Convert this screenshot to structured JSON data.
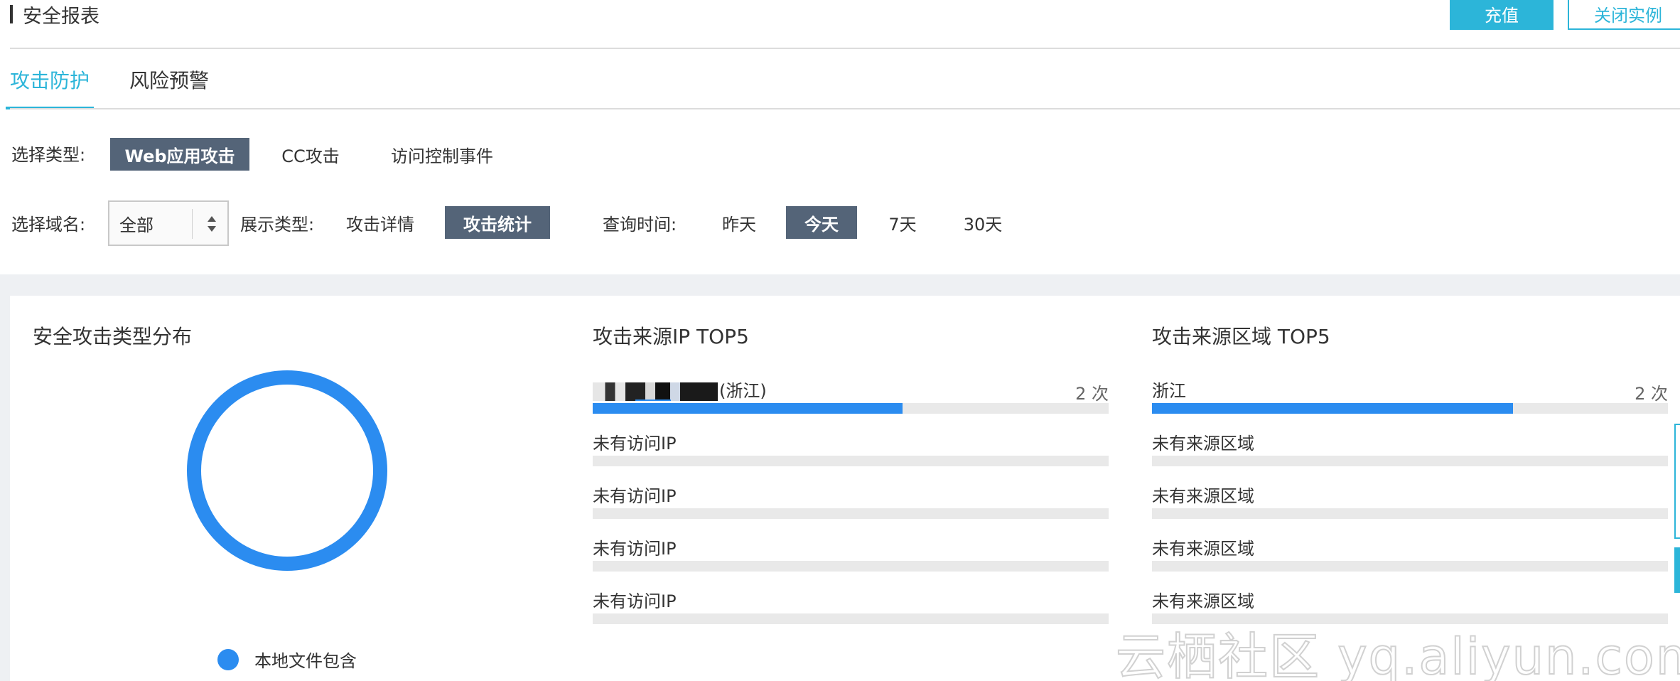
{
  "header": {
    "title": "安全报表",
    "recharge_label": "充值",
    "close_instance_label": "关闭实例"
  },
  "tabs": [
    {
      "label": "攻击防护",
      "active": true
    },
    {
      "label": "风险预警",
      "active": false
    }
  ],
  "filters": {
    "type_label": "选择类型:",
    "type_options": [
      {
        "label": "Web应用攻击",
        "active": true
      },
      {
        "label": "CC攻击",
        "active": false
      },
      {
        "label": "访问控制事件",
        "active": false
      }
    ],
    "domain_label": "选择域名:",
    "domain_value": "全部",
    "display_label": "展示类型:",
    "display_options": [
      {
        "label": "攻击详情",
        "active": false
      },
      {
        "label": "攻击统计",
        "active": true
      }
    ],
    "time_label": "查询时间:",
    "time_options": [
      {
        "label": "昨天",
        "active": false
      },
      {
        "label": "今天",
        "active": true
      },
      {
        "label": "7天",
        "active": false
      },
      {
        "label": "30天",
        "active": false
      }
    ]
  },
  "distribution": {
    "title": "安全攻击类型分布",
    "legend": [
      {
        "label": "本地文件包含",
        "color": "#2b8cf0"
      }
    ]
  },
  "ip_top5": {
    "title": "攻击来源IP TOP5",
    "rows": [
      {
        "label": "(浙江)",
        "count": "2 次",
        "fill": 0.6,
        "masked_ip": true
      },
      {
        "label": "未有访问IP",
        "count": "",
        "fill": 0
      },
      {
        "label": "未有访问IP",
        "count": "",
        "fill": 0
      },
      {
        "label": "未有访问IP",
        "count": "",
        "fill": 0
      },
      {
        "label": "未有访问IP",
        "count": "",
        "fill": 0
      }
    ]
  },
  "region_top5": {
    "title": "攻击来源区域 TOP5",
    "rows": [
      {
        "label": "浙江",
        "count": "2 次",
        "fill": 0.7
      },
      {
        "label": "未有来源区域",
        "count": "",
        "fill": 0
      },
      {
        "label": "未有来源区域",
        "count": "",
        "fill": 0
      },
      {
        "label": "未有来源区域",
        "count": "",
        "fill": 0
      },
      {
        "label": "未有来源区域",
        "count": "",
        "fill": 0
      }
    ]
  },
  "watermark": "云栖社区 yq.aliyun.com",
  "colors": {
    "accent": "#2cb5d9",
    "bar": "#2b8cf0",
    "active_option": "#546478"
  }
}
